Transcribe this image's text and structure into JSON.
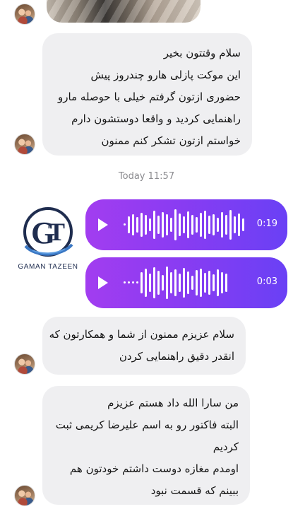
{
  "messages": {
    "top_image": {
      "icon": "image-preview"
    },
    "msg1": {
      "lines": [
        "سلام وقتتون بخیر",
        "این موکت پازلی هارو چندروز پیش",
        "حضوری ازتون گرفتم خیلی با حوصله مارو",
        "راهنمایی کردید و واقعا دوستشون دارم",
        "خواستم ازتون تشکر کنم ممنون"
      ]
    },
    "timestamp": "Today 11:57",
    "sender_logo": {
      "text": "GAMAN TAZEEN",
      "mark": "GT"
    },
    "voice_messages": [
      {
        "duration": "0:19",
        "played_fraction": 0.0
      },
      {
        "duration": "0:03",
        "played_fraction": 0.0
      }
    ],
    "msg2": {
      "lines": [
        "سلام عزیزم ممنون از شما و همکارتون که",
        "انقدر دقیق راهنمایی کردن"
      ]
    },
    "msg3": {
      "lines": [
        "من سارا الله داد هستم عزیزم",
        "البته فاکتور رو به اسم علیرضا کریمی ثبت",
        "کردیم",
        "اومدم مغازه دوست داشتم خودتون هم",
        "ببینم که قسمت نبود"
      ]
    }
  },
  "colors": {
    "bubble_incoming": "#efeff1",
    "voice_gradient_start": "#a23df0",
    "voice_gradient_end": "#6a40f5",
    "logo_navy": "#1f2d4f"
  }
}
